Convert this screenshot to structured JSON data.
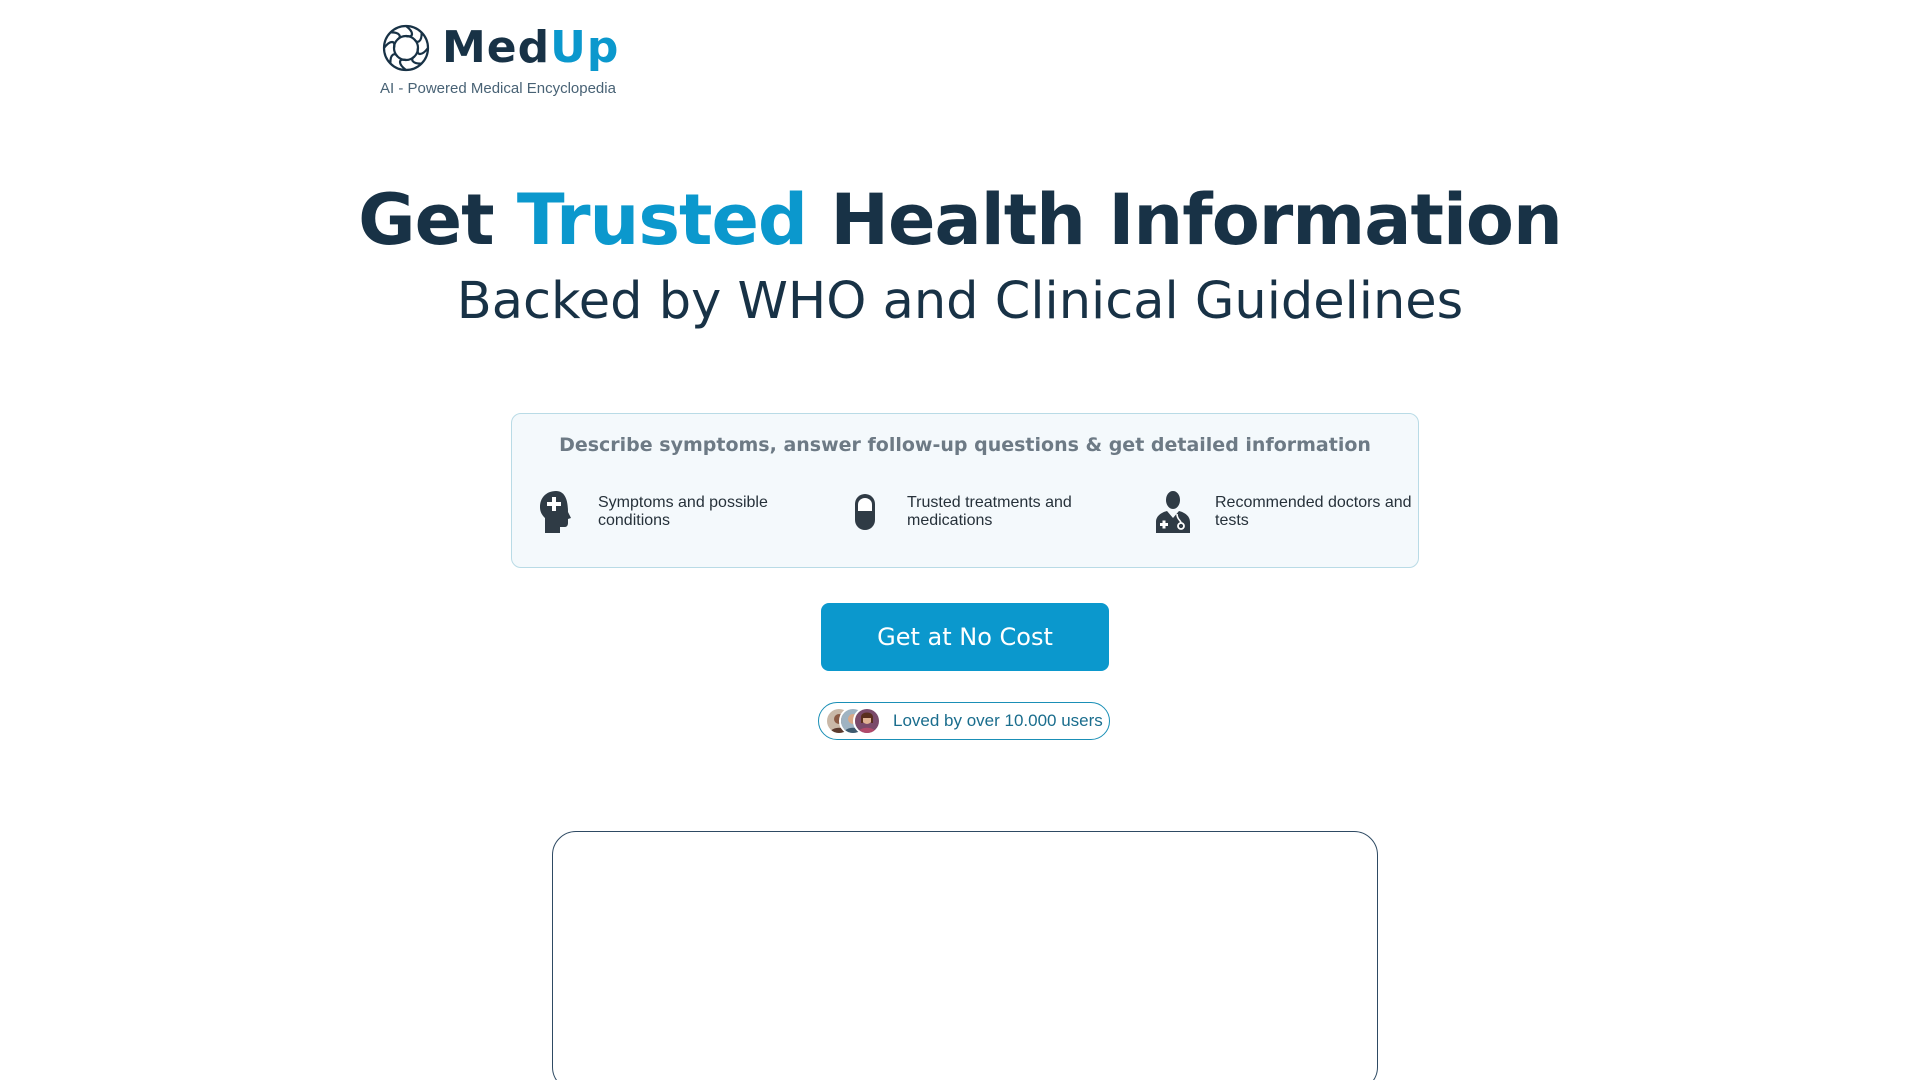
{
  "header": {
    "brand_part1": "Med",
    "brand_part2": "Up",
    "tagline": "AI - Powered Medical Encyclopedia",
    "logo_icon": "medup-logo-icon"
  },
  "hero": {
    "title_part1": "Get ",
    "title_accent": "Trusted",
    "title_part2": " Health Information",
    "subtitle": "Backed by WHO and Clinical Guidelines"
  },
  "feature_card": {
    "heading": "Describe symptoms, answer follow-up questions & get detailed information",
    "features": [
      {
        "icon": "head-plus-icon",
        "label": "Symptoms and possible conditions"
      },
      {
        "icon": "pill-capsule-icon",
        "label": "Trusted treatments and medications"
      },
      {
        "icon": "doctor-icon",
        "label": "Recommended doctors and tests"
      }
    ]
  },
  "cta": {
    "label": "Get at No Cost"
  },
  "social_proof": {
    "text": "Loved by over 10.000 users"
  },
  "colors": {
    "primary_dark": "#183246",
    "accent_blue": "#0b98cd",
    "card_bg": "#f4f9fc",
    "card_border": "#b9dbe6"
  }
}
